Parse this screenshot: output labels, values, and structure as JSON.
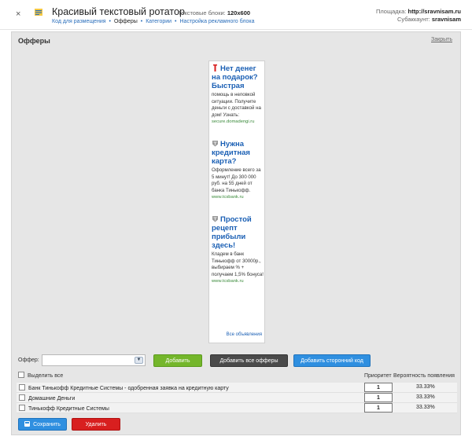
{
  "header": {
    "close_icon": "×",
    "title": "Красивый текстовый ротатор",
    "blocks_label": "Текстовые блоки:",
    "blocks_value": "120x600",
    "breadcrumb": [
      "Код для размещения",
      "Офферы",
      "Категории",
      "Настройка рекламного блока"
    ],
    "site_label": "Площадка:",
    "site_value": "http://sravnisam.ru",
    "subaccount_label": "Субаккаунт:",
    "subaccount_value": "sravnisam"
  },
  "panel": {
    "title": "Офферы",
    "close_label": "Закрыть"
  },
  "ads": [
    {
      "icon": "domadengi-icon",
      "title": "Нет денег на подарок? Быстрая",
      "body": "помощь в неловкой ситуации. Получите деньги с доставкой на дом! Узнать:",
      "url": "secure.domadengi.ru"
    },
    {
      "icon": "tinkoff-icon",
      "title": "Нужна кредитная карта?",
      "body": "Оформление всего за 5 минут! До 300 000 руб. на 55 дней от банка Тинькофф.",
      "url": "www.tcsbank.ru"
    },
    {
      "icon": "tinkoff-icon",
      "title": "Простой рецепт прибыли здесь!",
      "body": "Кладем в банк Тинькофф от 30000р., выбираем % + получаем 1,5% бонуса!",
      "url": "www.tcsbank.ru"
    }
  ],
  "all_ads_label": "Все объявления",
  "offer_select": {
    "label": "Оффер:",
    "value": ""
  },
  "buttons": {
    "add": "Добавить",
    "add_all": "Добавить все офферы",
    "add_external": "Добавить сторонний код",
    "save": "Сохранить",
    "delete": "Удалить"
  },
  "list": {
    "select_all": "Выделить все",
    "col_priority": "Приоритет",
    "col_probability": "Вероятность появления",
    "rows": [
      {
        "name": "Банк Тинькофф Кредитные Системы - одобренная заявка на кредитную карту",
        "priority": "1",
        "probability": "33.33%"
      },
      {
        "name": "Домашние Деньги",
        "priority": "1",
        "probability": "33.33%"
      },
      {
        "name": "Тинькофф Кредитные Системы",
        "priority": "1",
        "probability": "33.33%"
      }
    ]
  },
  "colors": {
    "link": "#1a5fb4",
    "green_button": "#74b62b",
    "dark_button": "#4a4a4a",
    "blue_button": "#2f8fe0",
    "red_button": "#d81f1f",
    "url_green": "#3a8a3a"
  }
}
